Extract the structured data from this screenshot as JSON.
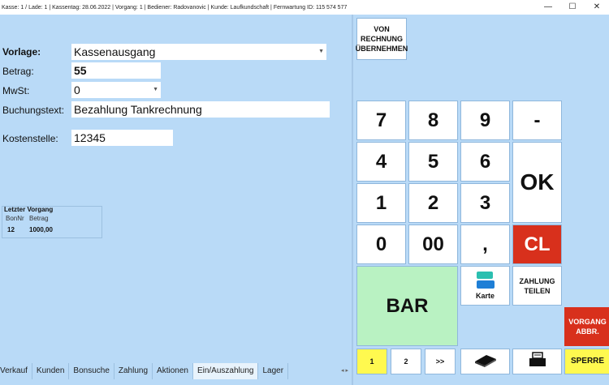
{
  "titlebar": {
    "text": "Kasse: 1 / Lade: 1  |  Kassentag: 28.06.2022  |  Vorgang: 1  |  Bediener:  Radovanovic  |  Kunde: Laufkundschaft     |  Fernwartung ID: 115 574 577",
    "minimize": "—",
    "maximize": "☐",
    "close": "✕"
  },
  "form": {
    "vorlage_label": "Vorlage:",
    "vorlage_value": "Kassenausgang",
    "betrag_label": "Betrag:",
    "betrag_value": "55",
    "mwst_label": "MwSt:",
    "mwst_value": "0",
    "buchungstext_label": "Buchungstext:",
    "buchungstext_value": "Bezahlung Tankrechnung",
    "kostenstelle_label": "Kostenstelle:",
    "kostenstelle_value": "12345"
  },
  "last_transaction": {
    "title": "Letzter Vorgang",
    "col_bonnr": "BonNr",
    "col_betrag": "Betrag",
    "bonnr": "12",
    "betrag": "1000,00"
  },
  "tabs": [
    "Verkauf",
    "Kunden",
    "Bonsuche",
    "Zahlung",
    "Aktionen",
    "Ein/Auszahlung",
    "Lager"
  ],
  "tab_arrows": "◂ ▸",
  "keypad": {
    "von_rechnung": "VON RECHNUNG ÜBERNEHMEN",
    "k7": "7",
    "k8": "8",
    "k9": "9",
    "minus": "-",
    "k4": "4",
    "k5": "5",
    "k6": "6",
    "ok": "OK",
    "k1": "1",
    "k2": "2",
    "k3": "3",
    "k0": "0",
    "k00": "00",
    "comma": ",",
    "cl": "CL",
    "bar": "BAR",
    "karte": "Karte",
    "zahlung_teilen": "ZAHLUNG TEILEN",
    "vorgang_abbr": "VORGANG ABBR.",
    "p1": "1",
    "p2": "2",
    "pnext": ">>",
    "sperre": "SPERRE"
  },
  "colors": {
    "background": "#b9daf7",
    "cl_red": "#d8301c",
    "bar_green": "#b9f2c2",
    "yellow": "#fff94f",
    "karte_blue": "#1e7fd6",
    "karte_teal": "#2bbfb0"
  }
}
